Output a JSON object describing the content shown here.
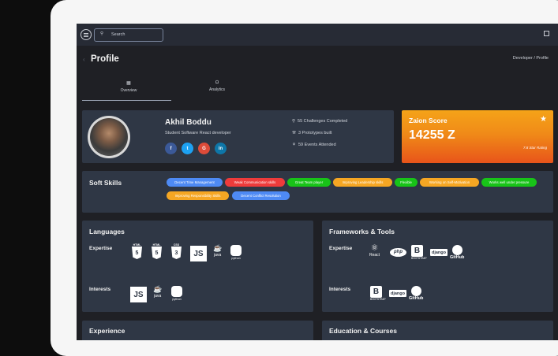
{
  "topbar": {
    "search_placeholder": "Search"
  },
  "page": {
    "title": "Profile",
    "breadcrumb": "Developer / Profile"
  },
  "tabs": [
    {
      "label": "Overview",
      "icon": "grid-icon"
    },
    {
      "label": "Analytics",
      "icon": "chart-icon"
    }
  ],
  "profile": {
    "name": "Akhil Boddu",
    "role": "Student Software React developer",
    "social": [
      "f",
      "t",
      "G",
      "in"
    ],
    "stats": [
      "55 Challenges Completed",
      "3 Prototypes built",
      "59 Events Attended"
    ]
  },
  "score": {
    "title": "Zaion Score",
    "value": "14255 Z",
    "subtitle": "7.8 Star Rating"
  },
  "soft_skills": {
    "title": "Soft Skills",
    "pills": [
      {
        "label": "Decent Time Management",
        "color": "#4e8af4"
      },
      {
        "label": "Weak Communication skills",
        "color": "#ee3b3b"
      },
      {
        "label": "Great Team player",
        "color": "#18c318"
      },
      {
        "label": "Improving Leadership skills",
        "color": "#f5a623"
      },
      {
        "label": "Flexible",
        "color": "#18c318"
      },
      {
        "label": "Working on Self-Motivation",
        "color": "#f5a623"
      },
      {
        "label": "Works well under pressure",
        "color": "#18c318"
      },
      {
        "label": "Improving Responsibility Skills",
        "color": "#f5a623"
      },
      {
        "label": "Decent Conflict Resolution",
        "color": "#4e8af4"
      }
    ]
  },
  "languages": {
    "title": "Languages",
    "expertise_label": "Expertise",
    "interests_label": "Interests",
    "expertise": [
      {
        "cap": "HTML",
        "glyph": "5"
      },
      {
        "cap": "HTML",
        "glyph": "5"
      },
      {
        "cap": "CSS",
        "glyph": "3"
      },
      {
        "box": "JS"
      },
      {
        "cap": "java"
      },
      {
        "cap": "python"
      }
    ],
    "interests": [
      {
        "box": "JS"
      },
      {
        "cap": "java"
      },
      {
        "cap": "python"
      }
    ]
  },
  "frameworks": {
    "title": "Frameworks & Tools",
    "expertise_label": "Expertise",
    "interests_label": "Interests",
    "expertise": [
      "React",
      "php",
      "B",
      "django",
      "GitHub"
    ],
    "interests": [
      "B",
      "django",
      "GitHub"
    ],
    "bootstrap_cap": "BOOTSTRAP"
  },
  "experience": {
    "title": "Experience"
  },
  "education": {
    "title": "Education & Courses"
  }
}
